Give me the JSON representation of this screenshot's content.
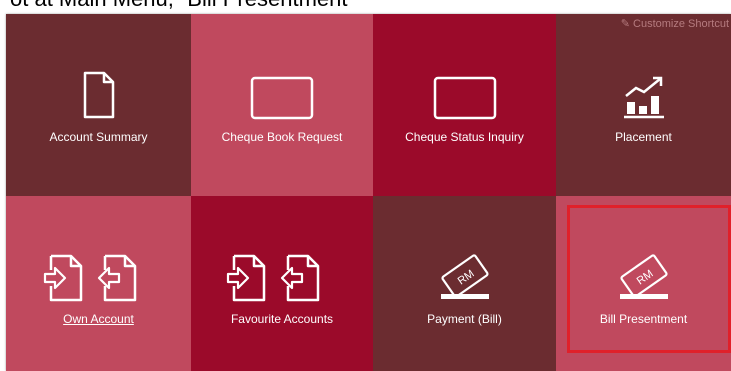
{
  "caption": "ot at Main Menu, “Bill Presentment”",
  "customize": {
    "label": "Customize Shortcut"
  },
  "tiles": [
    {
      "label": "Account Summary",
      "color": "#6b2c30",
      "icon": "document-icon"
    },
    {
      "label": "Cheque Book Request",
      "color": "#c0495e",
      "icon": "cheque-book-icon"
    },
    {
      "label": "Cheque Status Inquiry",
      "color": "#9b0a2a",
      "icon": "cheque-icon"
    },
    {
      "label": "Placement",
      "color": "#6b2c30",
      "icon": "growth-chart-icon"
    },
    {
      "label": "Own Account",
      "color": "#c0495e",
      "icon": "transfer-documents-icon"
    },
    {
      "label": "Favourite Accounts",
      "color": "#9b0a2a",
      "icon": "transfer-documents-icon"
    },
    {
      "label": "Payment (Bill)",
      "color": "#6b2c30",
      "icon": "bill-ticket-icon"
    },
    {
      "label": "Bill Presentment",
      "color": "#c0495e",
      "icon": "bill-ticket-icon"
    }
  ],
  "highlight_color": "#e0202a"
}
